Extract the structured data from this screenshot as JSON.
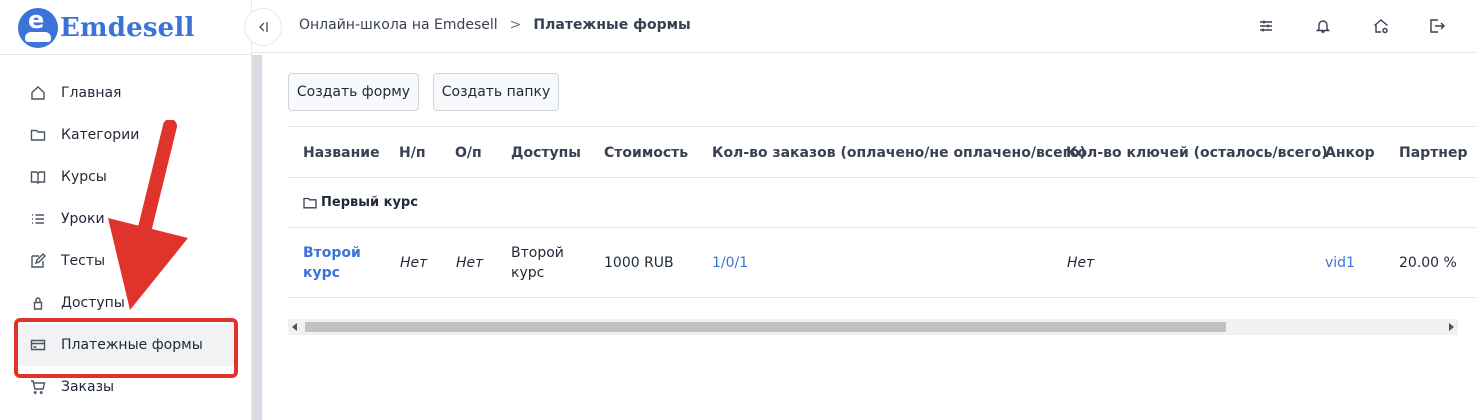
{
  "app": {
    "logo_letter": "e",
    "logo_text": "Emdesell"
  },
  "sidebar": {
    "items": [
      {
        "label": "Главная",
        "icon": "home-icon"
      },
      {
        "label": "Категории",
        "icon": "folder-icon"
      },
      {
        "label": "Курсы",
        "icon": "book-icon"
      },
      {
        "label": "Уроки",
        "icon": "list-icon"
      },
      {
        "label": "Тесты",
        "icon": "edit-icon"
      },
      {
        "label": "Доступы",
        "icon": "lock-icon"
      },
      {
        "label": "Платежные формы",
        "icon": "credit-card-icon",
        "active": true
      },
      {
        "label": "Заказы",
        "icon": "cart-icon"
      }
    ]
  },
  "header": {
    "breadcrumb_root": "Онлайн-школа на Emdesell",
    "breadcrumb_sep": ">",
    "breadcrumb_current": "Платежные формы"
  },
  "toolbar": {
    "create_form": "Создать форму",
    "create_folder": "Создать папку"
  },
  "table": {
    "columns": [
      "Название",
      "Н/п",
      "О/п",
      "Доступы",
      "Стоимость",
      "Кол-во заказов (оплачено/не оплачено/всего)",
      "Кол-во ключей (осталось/всего)",
      "Анкор",
      "Партнер"
    ],
    "folder": {
      "name": "Первый курс"
    },
    "rows": [
      {
        "name_line1": "Второй",
        "name_line2": "курс",
        "np": "Нет",
        "op": "Нет",
        "access_line1": "Второй",
        "access_line2": "курс",
        "price": "1000 RUB",
        "orders": "1/0/1",
        "keys": "Нет",
        "anchor": "vid1",
        "partner": "20.00 %"
      }
    ]
  },
  "colors": {
    "accent": "#3b73d9",
    "highlight": "#e0332c"
  }
}
